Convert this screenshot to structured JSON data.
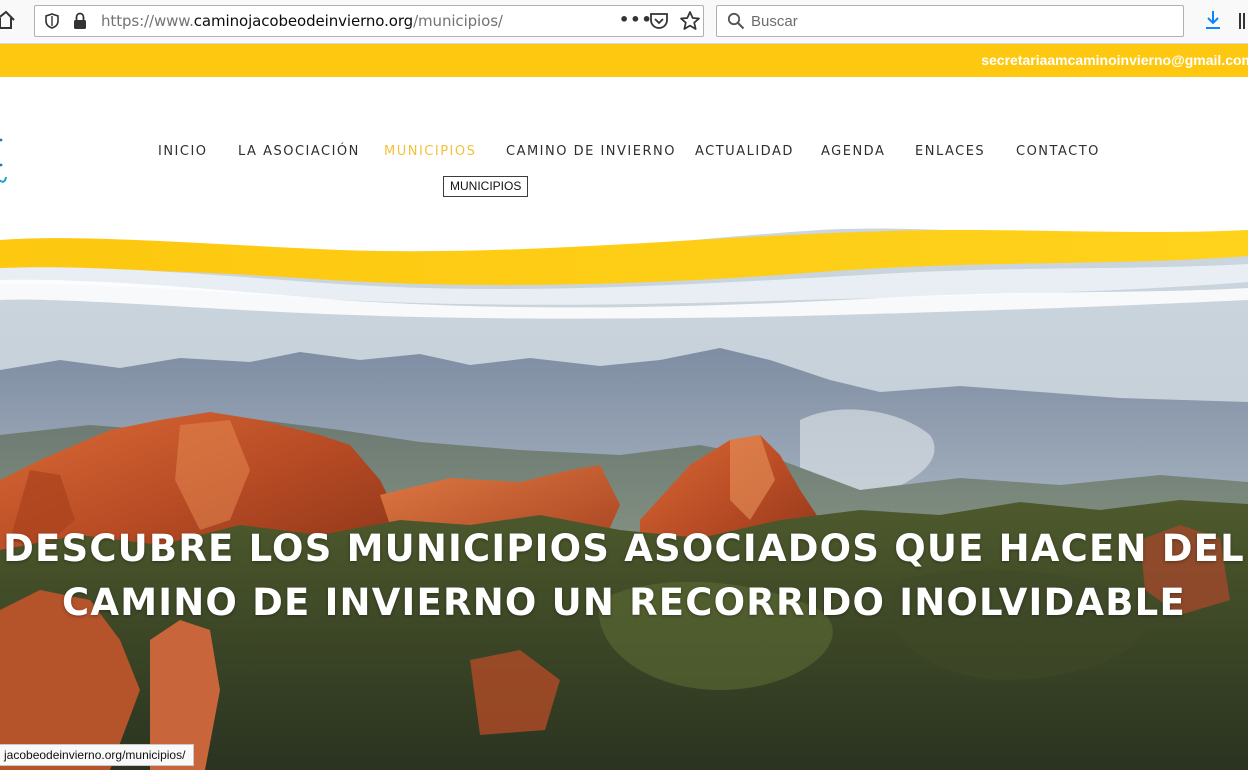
{
  "browser": {
    "url_prefix": "https://www.",
    "url_domain": "caminojacobeodeinvierno.org",
    "url_path": "/municipios/",
    "more_label": "•••",
    "search_placeholder": "Buscar"
  },
  "topbar": {
    "email": "secretariaamcaminoinvierno@gmail.com",
    "color": "#fdc80f"
  },
  "nav": {
    "items": [
      {
        "label": "INICIO",
        "active": false
      },
      {
        "label": "LA ASOCIACIÓN",
        "active": false
      },
      {
        "label": "MUNICIPIOS",
        "active": true
      },
      {
        "label": "CAMINO DE INVIERNO",
        "active": false
      },
      {
        "label": "ACTUALIDAD",
        "active": false
      },
      {
        "label": "AGENDA",
        "active": false
      },
      {
        "label": "ENLACES",
        "active": false
      },
      {
        "label": "CONTACTO",
        "active": false
      }
    ],
    "active_color": "#f2c23c",
    "tooltip": "MUNICIPIOS"
  },
  "hero": {
    "title_line1": "DESCUBRE LOS MUNICIPIOS ASOCIADOS QUE HACEN DEL",
    "title_line2": "CAMINO DE INVIERNO UN RECORRIDO INOLVIDABLE"
  },
  "statusbar": {
    "text": "jacobeodeinvierno.org/municipios/"
  },
  "icons": [
    "home-icon",
    "shield-icon",
    "lock-icon",
    "pocket-icon",
    "star-icon",
    "magnifier-icon",
    "download-icon",
    "library-icon"
  ]
}
